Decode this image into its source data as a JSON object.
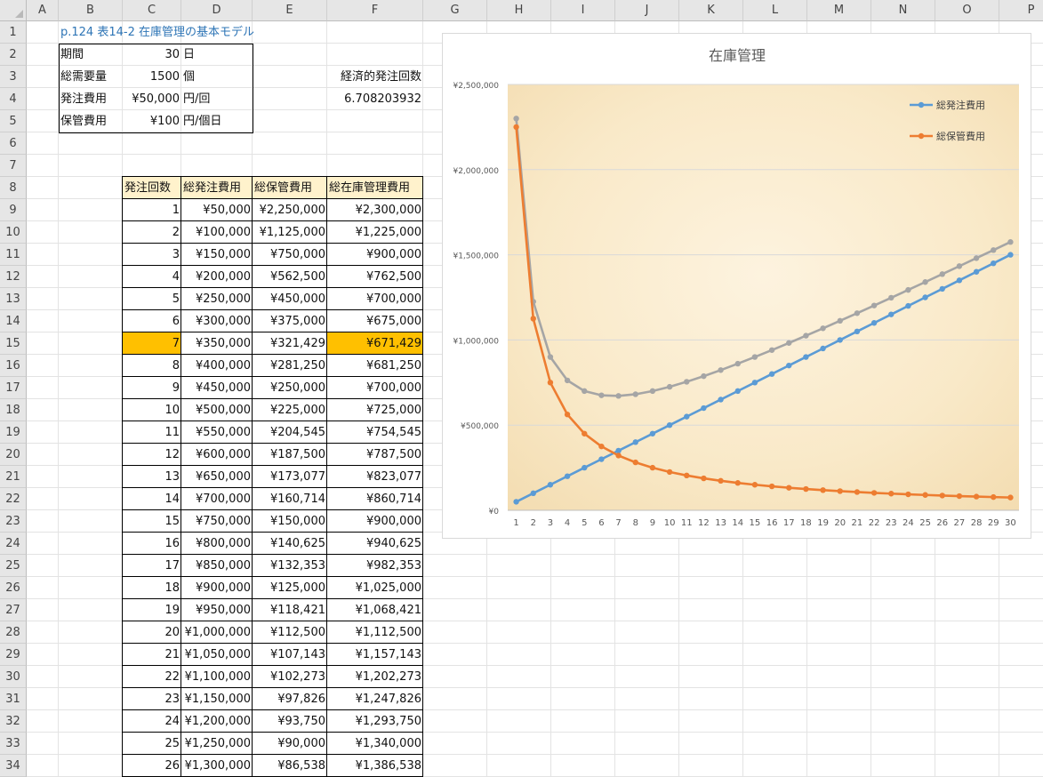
{
  "columns": [
    "A",
    "B",
    "C",
    "D",
    "E",
    "F",
    "G",
    "H",
    "I",
    "J",
    "K",
    "L",
    "M",
    "N",
    "O",
    "P"
  ],
  "rows_visible": [
    1,
    2,
    3,
    4,
    5,
    6,
    7,
    8,
    9,
    10,
    11,
    12,
    13,
    14,
    15,
    16,
    17,
    18,
    19,
    20,
    21,
    22,
    23,
    24,
    25,
    26,
    27,
    28,
    29,
    30,
    31,
    32,
    33,
    34
  ],
  "title_cell": "p.124 表14-2 在庫管理の基本モデル",
  "params": [
    {
      "label": "期間",
      "value": "30",
      "unit": "日"
    },
    {
      "label": "総需要量",
      "value": "1500",
      "unit": "個"
    },
    {
      "label": "発注費用",
      "value": "¥50,000",
      "unit": "円/回"
    },
    {
      "label": "保管費用",
      "value": "¥100",
      "unit": "円/個日"
    }
  ],
  "eoq": {
    "label": "経済的発注回数",
    "value": "6.708203932"
  },
  "table": {
    "headers": [
      "発注回数",
      "総発注費用",
      "総保管費用",
      "総在庫管理費用"
    ],
    "highlight_row_index": 6,
    "highlight_color": "#ffc000",
    "header_fill": "#fff2cc",
    "rows": [
      [
        "1",
        "¥50,000",
        "¥2,250,000",
        "¥2,300,000"
      ],
      [
        "2",
        "¥100,000",
        "¥1,125,000",
        "¥1,225,000"
      ],
      [
        "3",
        "¥150,000",
        "¥750,000",
        "¥900,000"
      ],
      [
        "4",
        "¥200,000",
        "¥562,500",
        "¥762,500"
      ],
      [
        "5",
        "¥250,000",
        "¥450,000",
        "¥700,000"
      ],
      [
        "6",
        "¥300,000",
        "¥375,000",
        "¥675,000"
      ],
      [
        "7",
        "¥350,000",
        "¥321,429",
        "¥671,429"
      ],
      [
        "8",
        "¥400,000",
        "¥281,250",
        "¥681,250"
      ],
      [
        "9",
        "¥450,000",
        "¥250,000",
        "¥700,000"
      ],
      [
        "10",
        "¥500,000",
        "¥225,000",
        "¥725,000"
      ],
      [
        "11",
        "¥550,000",
        "¥204,545",
        "¥754,545"
      ],
      [
        "12",
        "¥600,000",
        "¥187,500",
        "¥787,500"
      ],
      [
        "13",
        "¥650,000",
        "¥173,077",
        "¥823,077"
      ],
      [
        "14",
        "¥700,000",
        "¥160,714",
        "¥860,714"
      ],
      [
        "15",
        "¥750,000",
        "¥150,000",
        "¥900,000"
      ],
      [
        "16",
        "¥800,000",
        "¥140,625",
        "¥940,625"
      ],
      [
        "17",
        "¥850,000",
        "¥132,353",
        "¥982,353"
      ],
      [
        "18",
        "¥900,000",
        "¥125,000",
        "¥1,025,000"
      ],
      [
        "19",
        "¥950,000",
        "¥118,421",
        "¥1,068,421"
      ],
      [
        "20",
        "¥1,000,000",
        "¥112,500",
        "¥1,112,500"
      ],
      [
        "21",
        "¥1,050,000",
        "¥107,143",
        "¥1,157,143"
      ],
      [
        "22",
        "¥1,100,000",
        "¥102,273",
        "¥1,202,273"
      ],
      [
        "23",
        "¥1,150,000",
        "¥97,826",
        "¥1,247,826"
      ],
      [
        "24",
        "¥1,200,000",
        "¥93,750",
        "¥1,293,750"
      ],
      [
        "25",
        "¥1,250,000",
        "¥90,000",
        "¥1,340,000"
      ],
      [
        "26",
        "¥1,300,000",
        "¥86,538",
        "¥1,386,538"
      ]
    ]
  },
  "colors": {
    "order": "#5b9bd5",
    "holding": "#ed7d31",
    "total": "#a5a5a5",
    "title_blue": "#2e75b6"
  },
  "chart_data": {
    "type": "line",
    "title": "在庫管理",
    "x": [
      1,
      2,
      3,
      4,
      5,
      6,
      7,
      8,
      9,
      10,
      11,
      12,
      13,
      14,
      15,
      16,
      17,
      18,
      19,
      20,
      21,
      22,
      23,
      24,
      25,
      26,
      27,
      28,
      29,
      30
    ],
    "ylim": [
      0,
      2500000
    ],
    "yticks": [
      0,
      500000,
      1000000,
      1500000,
      2000000,
      2500000
    ],
    "ytick_labels": [
      "¥0",
      "¥500,000",
      "¥1,000,000",
      "¥1,500,000",
      "¥2,000,000",
      "¥2,500,000"
    ],
    "legend_position": "top-right",
    "grid": true,
    "series": [
      {
        "name": "総発注費用",
        "color": "#5b9bd5",
        "values": [
          50000,
          100000,
          150000,
          200000,
          250000,
          300000,
          350000,
          400000,
          450000,
          500000,
          550000,
          600000,
          650000,
          700000,
          750000,
          800000,
          850000,
          900000,
          950000,
          1000000,
          1050000,
          1100000,
          1150000,
          1200000,
          1250000,
          1300000,
          1350000,
          1400000,
          1450000,
          1500000
        ]
      },
      {
        "name": "総保管費用",
        "color": "#ed7d31",
        "values": [
          2250000,
          1125000,
          750000,
          562500,
          450000,
          375000,
          321429,
          281250,
          250000,
          225000,
          204545,
          187500,
          173077,
          160714,
          150000,
          140625,
          132353,
          125000,
          118421,
          112500,
          107143,
          102273,
          97826,
          93750,
          90000,
          86538,
          83333,
          80357,
          77586,
          75000
        ]
      },
      {
        "color": "#a5a5a5",
        "values": [
          2300000,
          1225000,
          900000,
          762500,
          700000,
          675000,
          671429,
          681250,
          700000,
          725000,
          754545,
          787500,
          823077,
          860714,
          900000,
          940625,
          982353,
          1025000,
          1068421,
          1112500,
          1157143,
          1202273,
          1247826,
          1293750,
          1340000,
          1386538,
          1433333,
          1480357,
          1527586,
          1575000
        ]
      }
    ]
  }
}
